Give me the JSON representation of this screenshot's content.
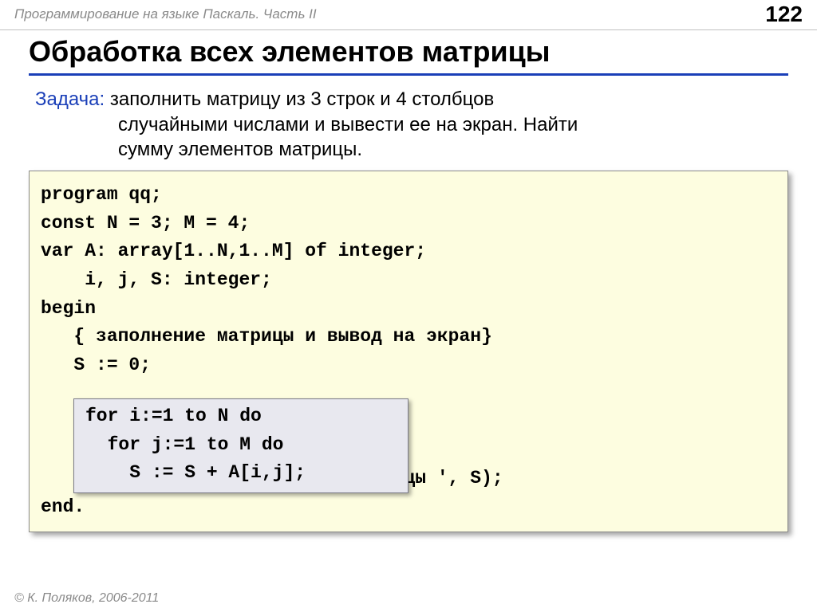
{
  "header": {
    "doc_title": "Программирование на языке Паскаль. Часть II",
    "page_number": "122"
  },
  "slide": {
    "title": "Обработка всех элементов матрицы",
    "task_label": "Задача:",
    "task_line1": "заполнить матрицу из 3 строк и 4 столбцов",
    "task_line2": "случайными числами и вывести ее на экран. Найти",
    "task_line3": "сумму элементов матрицы."
  },
  "code": {
    "l1": "program qq;",
    "l2": "const N = 3; M = 4;",
    "l3": "var A: array[1..N,1..M] of integer;",
    "l4": "    i, j, S: integer;",
    "l5": "begin",
    "l6": "   { заполнение матрицы и вывод на экран}",
    "l7": "   S := 0;",
    "l8": " ",
    "l9": " ",
    "l10": " ",
    "l11": "   writeln('Сумма элементов матрицы ', S);",
    "l12": "end."
  },
  "inner": {
    "l1": "for i:=1 to N do",
    "l2": "  for j:=1 to M do",
    "l3": "    S := S + A[i,j];"
  },
  "footer": {
    "copyright": "© К. Поляков, 2006-2011"
  }
}
